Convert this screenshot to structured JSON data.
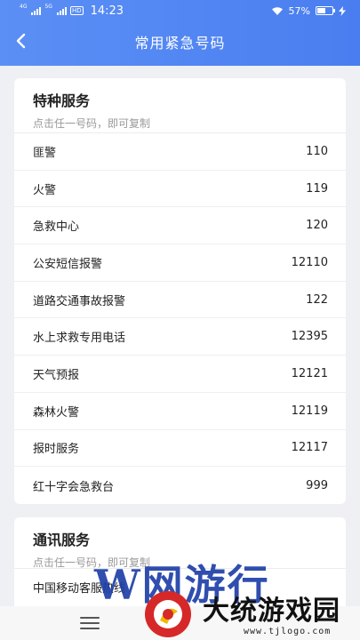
{
  "status_bar": {
    "signal1": "4G",
    "signal2": "5G",
    "hd": "HD",
    "time": "14:23",
    "battery_text": "57%",
    "battery_level": 0.57
  },
  "nav": {
    "title": "常用紧急号码"
  },
  "sections": [
    {
      "title": "特种服务",
      "subtitle": "点击任一号码，即可复制",
      "items": [
        {
          "name": "匪警",
          "number": "110"
        },
        {
          "name": "火警",
          "number": "119"
        },
        {
          "name": "急救中心",
          "number": "120"
        },
        {
          "name": "公安短信报警",
          "number": "12110"
        },
        {
          "name": "道路交通事故报警",
          "number": "122"
        },
        {
          "name": "水上求救专用电话",
          "number": "12395"
        },
        {
          "name": "天气预报",
          "number": "12121"
        },
        {
          "name": "森林火警",
          "number": "12119"
        },
        {
          "name": "报时服务",
          "number": "12117"
        },
        {
          "name": "红十字会急救台",
          "number": "999"
        }
      ]
    },
    {
      "title": "通讯服务",
      "subtitle": "点击任一号码，即可复制",
      "items": [
        {
          "name": "中国移动客服热线",
          "number": ""
        }
      ]
    }
  ],
  "watermark": {
    "brand_latin": "W",
    "brand_cn_top": "网游行",
    "brand_cn": "大统游戏园",
    "url": "www.tjlogo.com"
  },
  "colors": {
    "header_start": "#5b8ff5",
    "header_end": "#4a7ef0",
    "page_bg": "#eef0f4"
  }
}
